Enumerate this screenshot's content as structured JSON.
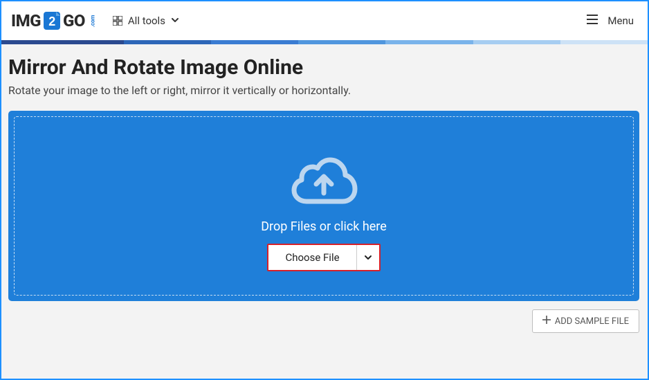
{
  "header": {
    "logo_img_pre": "IMG",
    "logo_go": "GO",
    "logo_com": ".com",
    "all_tools_label": "All tools",
    "menu_label": "Menu"
  },
  "page": {
    "title": "Mirror And Rotate Image Online",
    "subtitle": "Rotate your image to the left or right, mirror it vertically or horizontally."
  },
  "dropzone": {
    "text": "Drop Files or click here",
    "choose_file_label": "Choose File"
  },
  "actions": {
    "add_sample_label": "ADD SAMPLE FILE"
  },
  "colors": {
    "primary": "#1f7fd9",
    "highlight": "#d6212a"
  }
}
